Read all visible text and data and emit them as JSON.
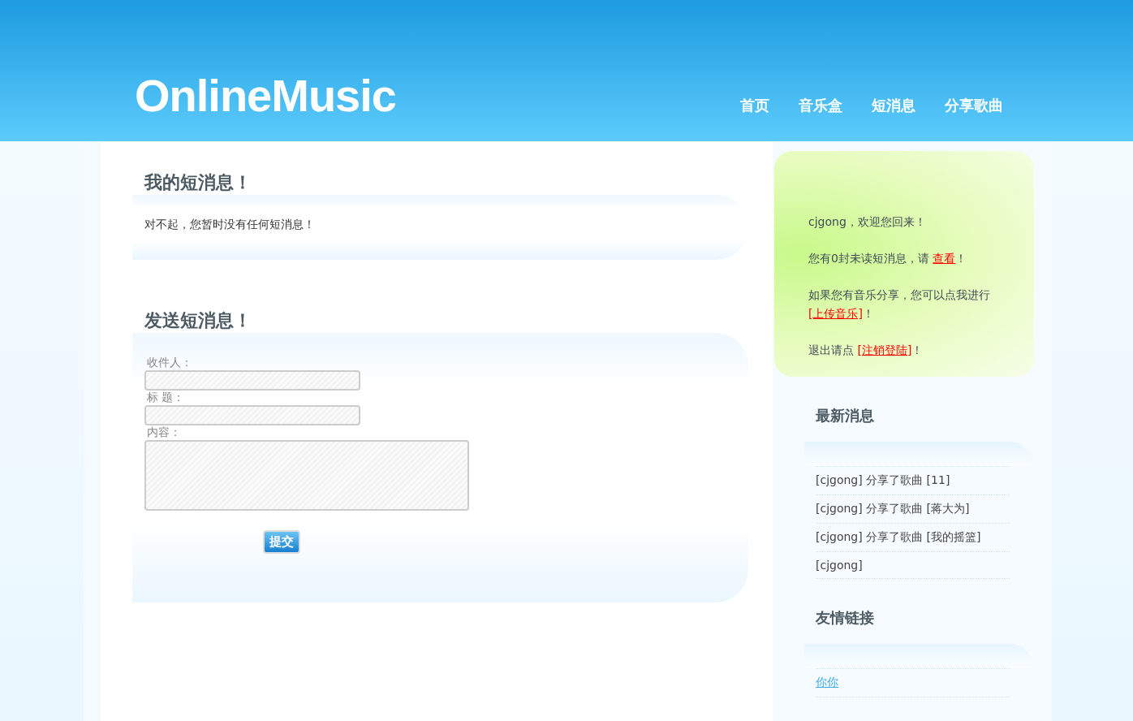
{
  "logo": "OnlineMusic",
  "nav": [
    {
      "label": "首页"
    },
    {
      "label": "音乐盒"
    },
    {
      "label": "短消息"
    },
    {
      "label": "分享歌曲"
    }
  ],
  "inbox": {
    "title": "我的短消息！",
    "message": "对不起，您暂时没有任何短消息！"
  },
  "compose": {
    "title": "发送短消息！",
    "fields": [
      {
        "label": "收件人：",
        "kind": "input"
      },
      {
        "label": "标 题：",
        "kind": "input"
      },
      {
        "label": "内容：",
        "kind": "textarea"
      }
    ],
    "submit": "提交"
  },
  "welcome": [
    [
      {
        "kind": "text",
        "text": "cjgong，欢迎您回来！"
      }
    ],
    [
      {
        "kind": "text",
        "text": "您有0封未读短消息，请 "
      },
      {
        "kind": "link",
        "text": "查看"
      },
      {
        "kind": "text",
        "text": "！"
      }
    ],
    [
      {
        "kind": "text",
        "text": "如果您有音乐分享，您可以点我进行 "
      },
      {
        "kind": "link",
        "text": "[上传音乐]"
      },
      {
        "kind": "text",
        "text": "！"
      }
    ],
    [
      {
        "kind": "text",
        "text": "退出请点 "
      },
      {
        "kind": "link",
        "text": "[注销登陆]"
      },
      {
        "kind": "text",
        "text": "！"
      }
    ]
  ],
  "news": {
    "title": "最新消息",
    "items": [
      "[cjgong] 分享了歌曲 [11]",
      "[cjgong] 分享了歌曲 [蒋大为]",
      "[cjgong] 分享了歌曲 [我的摇篮]",
      "[cjgong]"
    ]
  },
  "links": {
    "title": "友情链接",
    "items": [
      "你你"
    ]
  }
}
